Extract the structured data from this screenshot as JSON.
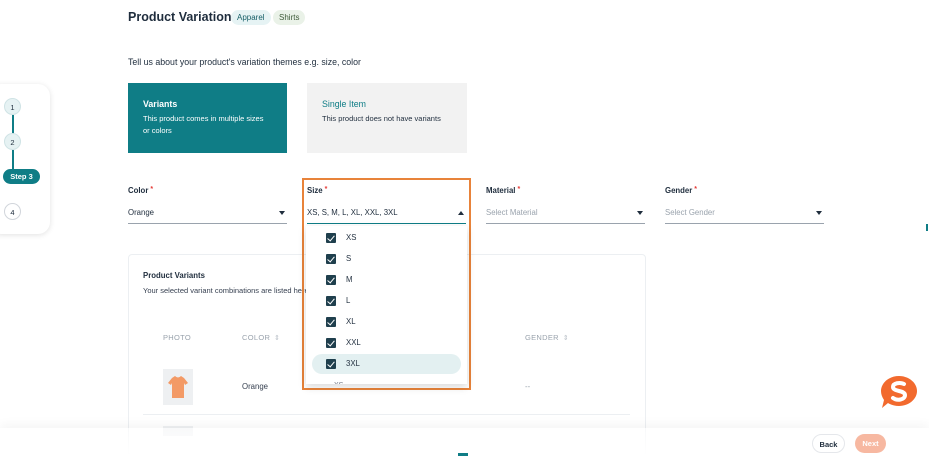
{
  "header": {
    "title": "Product Variations",
    "tags": [
      "Apparel",
      "Shirts"
    ],
    "subtitle": "Tell us about your product's variation themes e.g. size, color"
  },
  "stepper": {
    "steps": [
      "1",
      "2",
      "Step 3",
      "4"
    ],
    "active_index": 2
  },
  "variant_type": {
    "variants": {
      "title": "Variants",
      "description": "This product comes in multiple sizes or colors"
    },
    "single": {
      "title": "Single Item",
      "description": "This product does not have variants"
    },
    "selected": "Variants"
  },
  "attributes": {
    "color": {
      "label": "Color",
      "value": "Orange"
    },
    "size": {
      "label": "Size",
      "value": "XS, S, M, L, XL, XXL, 3XL"
    },
    "material": {
      "label": "Material",
      "placeholder": "Select Material"
    },
    "gender": {
      "label": "Gender",
      "placeholder": "Select Gender"
    },
    "required_mark": "*"
  },
  "size_options": [
    {
      "label": "XS",
      "checked": true
    },
    {
      "label": "S",
      "checked": true
    },
    {
      "label": "M",
      "checked": true
    },
    {
      "label": "L",
      "checked": true
    },
    {
      "label": "XL",
      "checked": true
    },
    {
      "label": "XXL",
      "checked": true
    },
    {
      "label": "3XL",
      "checked": true
    }
  ],
  "size_partial_next": "XS",
  "product_variants": {
    "title": "Product Variants",
    "description": "Your selected variant combinations are listed here",
    "columns": [
      "PHOTO",
      "COLOR",
      "GENDER"
    ],
    "rows": [
      {
        "color": "Orange",
        "gender": "--"
      }
    ]
  },
  "footer": {
    "back_label": "Back",
    "next_label": "Next"
  },
  "colors": {
    "primary": "#0f7d86",
    "accent": "#e8833a",
    "next_disabled": "#f7b8a1"
  }
}
